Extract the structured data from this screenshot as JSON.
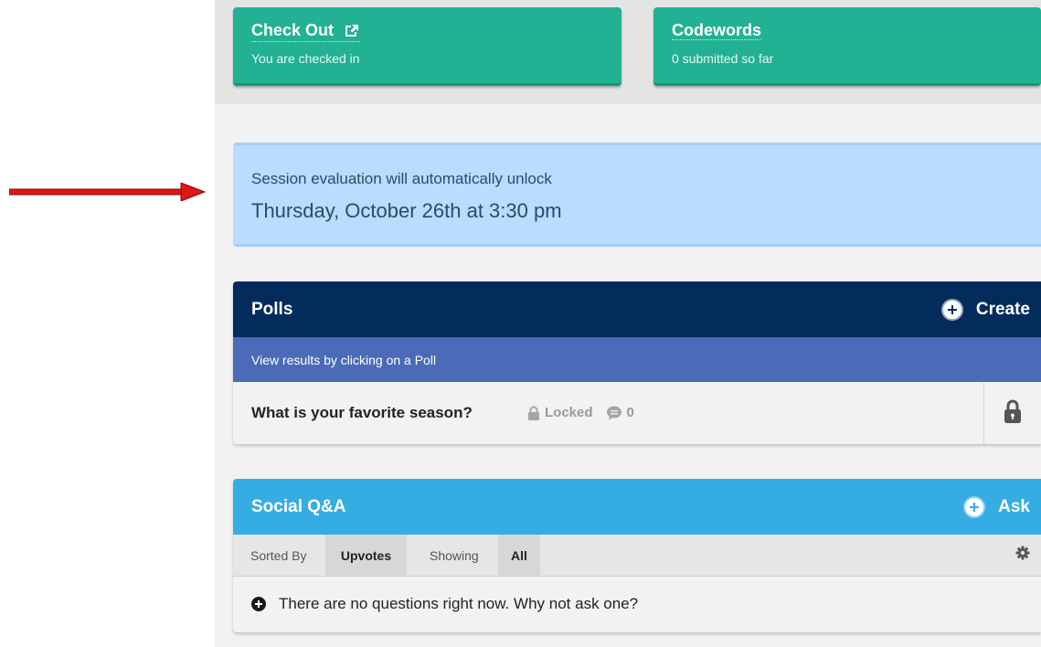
{
  "checkout": {
    "title": "Check Out",
    "subtitle": "You are checked in"
  },
  "codewords": {
    "title": "Codewords",
    "subtitle": "0 submitted so far"
  },
  "evaluation": {
    "line1": "Session evaluation will automatically unlock",
    "line2": "Thursday, October 26th at 3:30 pm"
  },
  "polls": {
    "title": "Polls",
    "action_label": "Create",
    "subtitle": "View results by clicking on a Poll",
    "items": [
      {
        "question": "What is your favorite season?",
        "status": "Locked",
        "responses": "0"
      }
    ]
  },
  "qa": {
    "title": "Social Q&A",
    "action_label": "Ask",
    "sorted_by_label": "Sorted By",
    "sorted_by_value": "Upvotes",
    "showing_label": "Showing",
    "showing_value": "All",
    "empty_message": "There are no questions right now. Why not ask one?"
  },
  "colors": {
    "tile_green": "#22b193",
    "polls_header": "#032b5c",
    "polls_subheader": "#4b6bb8",
    "qa_header": "#35ade3",
    "alert_bg": "#b9dcff",
    "annotation_arrow": "#e31515"
  },
  "icons": {
    "checkout": "share-external-icon",
    "create": "plus-circle-icon",
    "ask": "plus-circle-icon",
    "locked": "lock-icon",
    "responses": "comment-icon",
    "row_lock": "lock-icon",
    "settings": "gear-icon",
    "empty": "plus-circle-icon",
    "annotation": "red-arrow-icon"
  }
}
